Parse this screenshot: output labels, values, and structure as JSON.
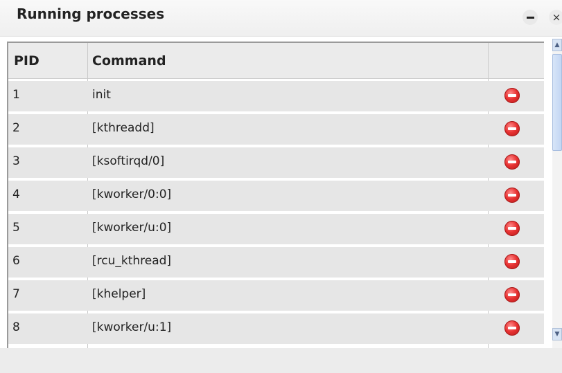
{
  "window": {
    "title": "Running processes",
    "minimize_icon": "minimize-icon",
    "close_icon": "close-icon",
    "close_glyph": "×"
  },
  "table": {
    "columns": [
      "PID",
      "Command",
      ""
    ],
    "rows": [
      {
        "pid": "1",
        "command": "init"
      },
      {
        "pid": "2",
        "command": "[kthreadd]"
      },
      {
        "pid": "3",
        "command": "[ksoftirqd/0]"
      },
      {
        "pid": "4",
        "command": "[kworker/0:0]"
      },
      {
        "pid": "5",
        "command": "[kworker/u:0]"
      },
      {
        "pid": "6",
        "command": "[rcu_kthread]"
      },
      {
        "pid": "7",
        "command": "[khelper]"
      },
      {
        "pid": "8",
        "command": "[kworker/u:1]"
      }
    ],
    "row_action_icon": "kill-process-icon"
  },
  "colors": {
    "header_bg": "#ebebeb",
    "row_bg": "#e6e6e6",
    "kill_red": "#e83232",
    "scroll_blue": "#c3d6f3"
  }
}
